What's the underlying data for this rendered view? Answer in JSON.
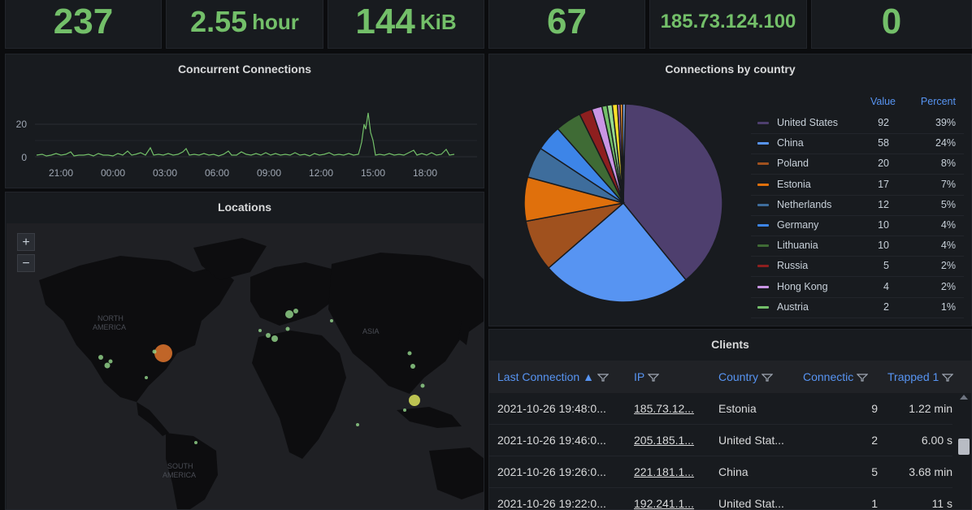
{
  "stats": [
    {
      "value": "237",
      "unit": ""
    },
    {
      "value": "2.55",
      "unit": "hour"
    },
    {
      "value": "144",
      "unit": "KiB"
    },
    {
      "value": "67",
      "unit": ""
    },
    {
      "value": "185.73.124.100",
      "unit": ""
    },
    {
      "value": "0",
      "unit": ""
    }
  ],
  "concurrent": {
    "title": "Concurrent Connections",
    "y_ticks": [
      "20",
      "0"
    ],
    "x_ticks": [
      "21:00",
      "00:00",
      "03:00",
      "06:00",
      "09:00",
      "12:00",
      "15:00",
      "18:00"
    ]
  },
  "locations": {
    "title": "Locations",
    "zoom_in": "+",
    "zoom_out": "−",
    "labels": [
      "NORTH",
      "AMERICA",
      "ASIA",
      "SOUTH",
      "AMERICA"
    ]
  },
  "pie": {
    "title": "Connections by country",
    "value_header": "Value",
    "percent_header": "Percent"
  },
  "chart_data": {
    "type": "pie",
    "title": "Connections by country",
    "slices": [
      {
        "name": "United States",
        "value": 92,
        "percent": "39%",
        "color": "#4e3f6e"
      },
      {
        "name": "China",
        "value": 58,
        "percent": "24%",
        "color": "#5794f2"
      },
      {
        "name": "Poland",
        "value": 20,
        "percent": "8%",
        "color": "#a0511e"
      },
      {
        "name": "Estonia",
        "value": 17,
        "percent": "7%",
        "color": "#e0700c"
      },
      {
        "name": "Netherlands",
        "value": 12,
        "percent": "5%",
        "color": "#3e6d9c"
      },
      {
        "name": "Germany",
        "value": 10,
        "percent": "4%",
        "color": "#3d85e8"
      },
      {
        "name": "Lithuania",
        "value": 10,
        "percent": "4%",
        "color": "#3f6b35"
      },
      {
        "name": "Russia",
        "value": 5,
        "percent": "2%",
        "color": "#8e1f1f"
      },
      {
        "name": "Hong Kong",
        "value": 4,
        "percent": "2%",
        "color": "#ca95e5"
      },
      {
        "name": "Austria",
        "value": 2,
        "percent": "1%",
        "color": "#73bf69"
      },
      {
        "name": "",
        "value": 2,
        "percent": "",
        "color": "#96d98d"
      },
      {
        "name": "",
        "value": 2,
        "percent": "",
        "color": "#fade2a"
      },
      {
        "name": "",
        "value": 1,
        "percent": "",
        "color": "#b877d9"
      },
      {
        "name": "",
        "value": 1,
        "percent": "",
        "color": "#ff9830"
      },
      {
        "name": "",
        "value": 1,
        "percent": "",
        "color": "#8ab8ff"
      }
    ]
  },
  "clients": {
    "title": "Clients",
    "headers": [
      "Last Connection ▲",
      "IP",
      "Country",
      "Connectic",
      "Trapped 1"
    ],
    "rows": [
      [
        "2021-10-26 19:48:0...",
        "185.73.12...",
        "Estonia",
        "9",
        "1.22 min"
      ],
      [
        "2021-10-26 19:46:0...",
        "205.185.1...",
        "United Stat...",
        "2",
        "6.00 s"
      ],
      [
        "2021-10-26 19:26:0...",
        "221.181.1...",
        "China",
        "5",
        "3.68 min"
      ],
      [
        "2021-10-26 19:22:0...",
        "192.241.1...",
        "United Stat...",
        "1",
        "11 s"
      ]
    ]
  },
  "colors": {
    "stat_green": "#73bf69",
    "header_blue": "#5794f2",
    "panel_bg": "#181b1f",
    "page_bg": "#0b0c0e"
  }
}
